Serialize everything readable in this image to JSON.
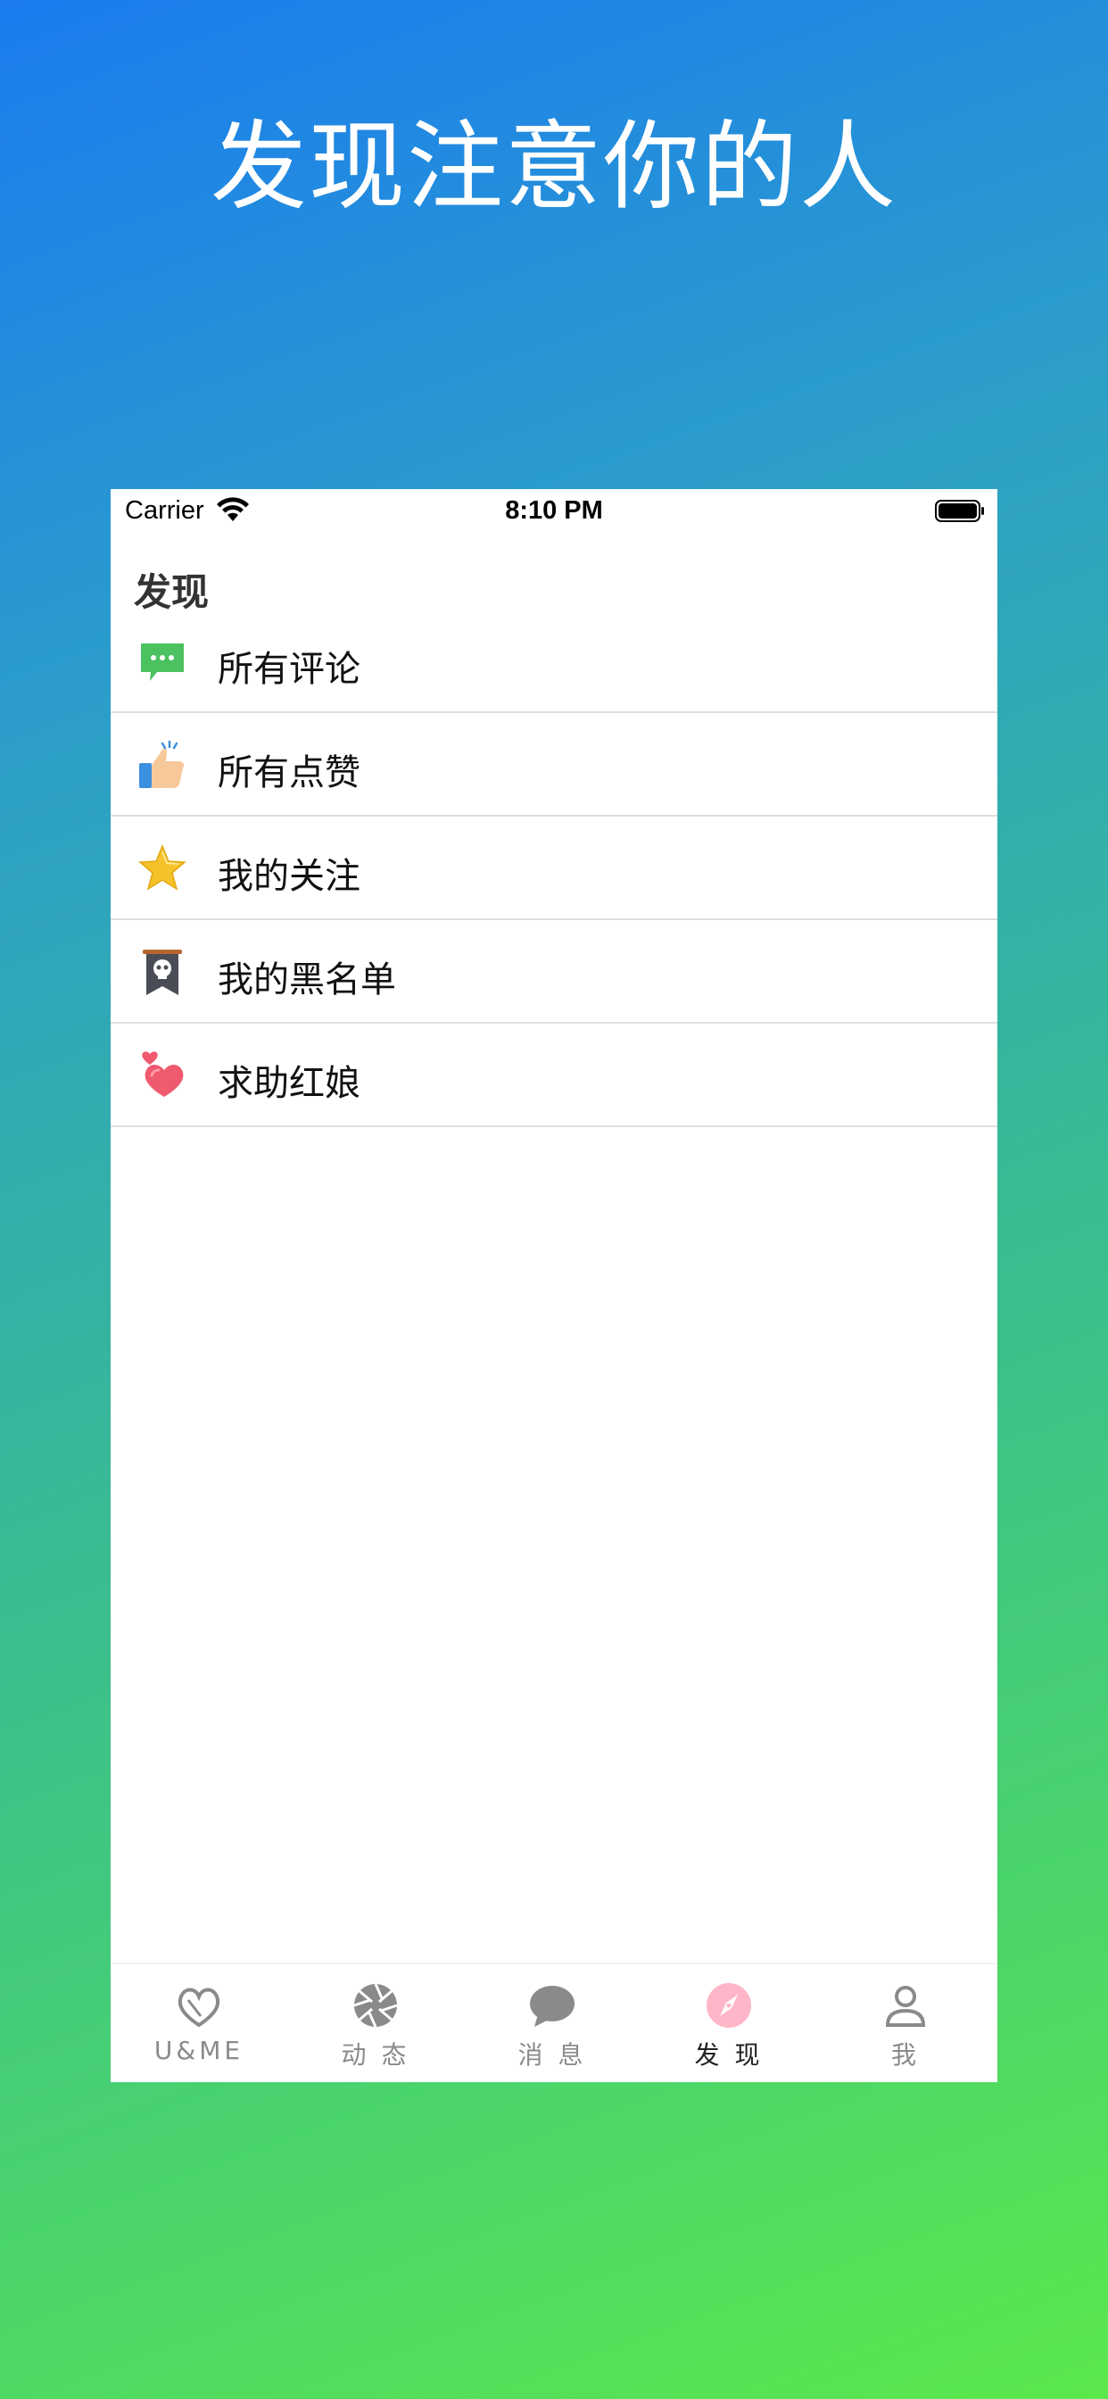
{
  "headline": "发现注意你的人",
  "status_bar": {
    "carrier": "Carrier",
    "time": "8:10 PM"
  },
  "nav": {
    "title": "发现"
  },
  "menu": [
    {
      "label": "所有评论",
      "icon": "comment-icon"
    },
    {
      "label": "所有点赞",
      "icon": "thumbs-up-icon"
    },
    {
      "label": "我的关注",
      "icon": "star-icon"
    },
    {
      "label": "我的黑名单",
      "icon": "skull-banner-icon"
    },
    {
      "label": "求助红娘",
      "icon": "hearts-icon"
    }
  ],
  "tabs": [
    {
      "label": "U&ME",
      "icon": "heart-outline-icon"
    },
    {
      "label": "动 态",
      "icon": "aperture-icon"
    },
    {
      "label": "消 息",
      "icon": "chat-bubble-icon"
    },
    {
      "label": "发 现",
      "icon": "compass-icon",
      "active": true
    },
    {
      "label": "我",
      "icon": "person-icon"
    }
  ],
  "colors": {
    "active_tab": "#ffb6c8",
    "inactive_tab": "#8a8a8a",
    "gradient_top": "#1a7cf0",
    "gradient_bottom": "#5ae84c"
  }
}
